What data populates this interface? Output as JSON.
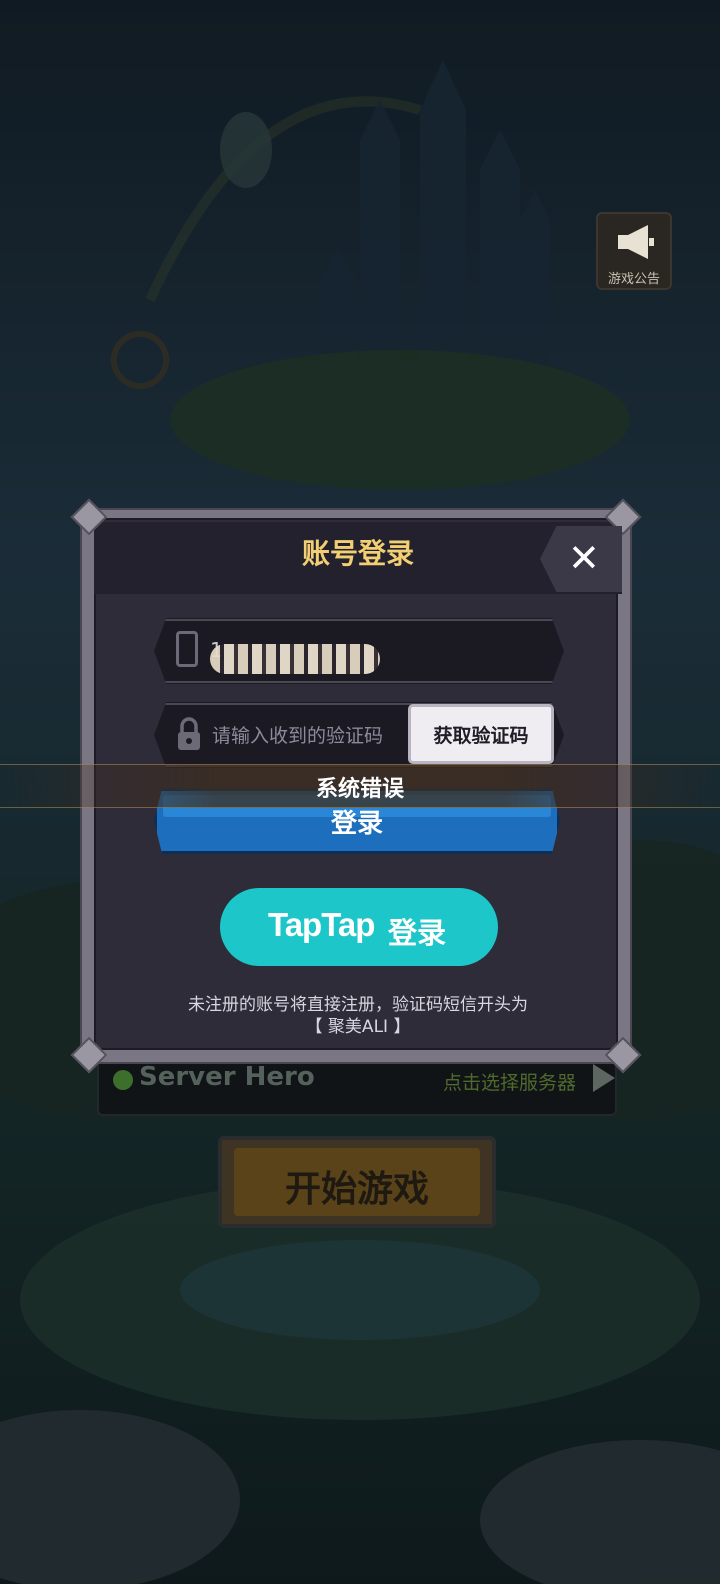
{
  "announcement": {
    "label": "游戏公告",
    "icon": "megaphone-icon"
  },
  "dialog": {
    "title": "账号登录",
    "close_icon": "close-icon"
  },
  "phone": {
    "icon": "phone-icon",
    "value": "1"
  },
  "code": {
    "icon": "lock-icon",
    "placeholder": "请输入收到的验证码",
    "get_code_label": "获取验证码"
  },
  "toast": {
    "text": "系统错误"
  },
  "login": {
    "label": "登录"
  },
  "taptap": {
    "brand": "TapTap",
    "label": "登录"
  },
  "notice": {
    "line1": "未注册的账号将直接注册，验证码短信开头为",
    "line2": "【 聚美ALI 】"
  },
  "server": {
    "name": "Server Hero",
    "select_label": "点击选择服务器"
  },
  "start": {
    "label": "开始游戏"
  },
  "colors": {
    "title_gold": "#f2cf72",
    "login_blue": "#1d6fbd",
    "taptap_teal": "#1cc6c9"
  }
}
